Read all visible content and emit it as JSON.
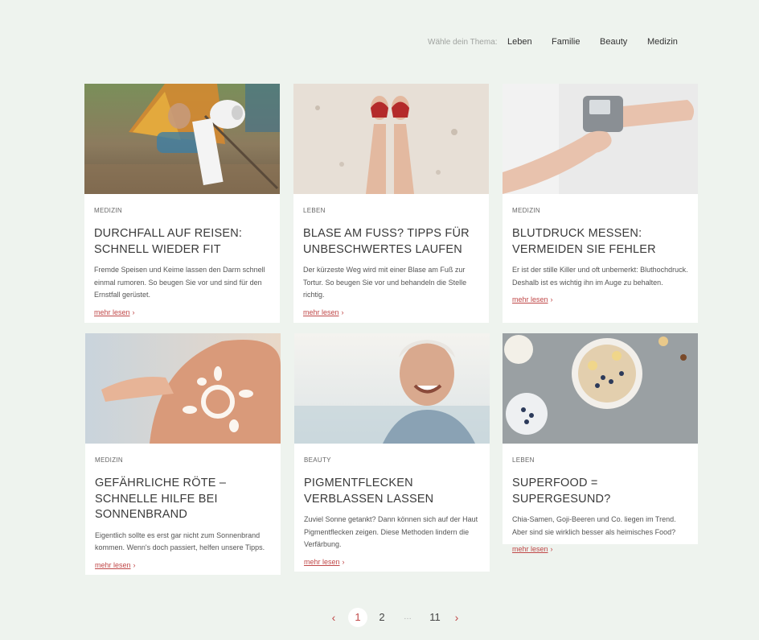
{
  "header": {
    "theme_prompt": "Wähle dein Thema:",
    "nav": [
      "Leben",
      "Familie",
      "Beauty",
      "Medizin"
    ]
  },
  "articles": [
    {
      "category": "MEDIZIN",
      "title": "DURCHFALL AUF REISEN: SCHNELL WIEDER FIT",
      "excerpt": "Fremde Speisen und Keime lassen den Darm schnell einmal rumoren. So beugen Sie vor und sind für den Ernstfall gerüstet.",
      "more": "mehr lesen"
    },
    {
      "category": "LEBEN",
      "title": "BLASE AM FUSS? TIPPS FÜR UNBESCHWERTES LAUFEN",
      "excerpt": "Der kürzeste Weg wird mit einer Blase am Fuß zur Tortur. So beugen Sie vor und behandeln die Stelle richtig.",
      "more": "mehr lesen"
    },
    {
      "category": "MEDIZIN",
      "title": "BLUTDRUCK MESSEN: VERMEIDEN SIE FEHLER",
      "excerpt": "Er ist der stille Killer und oft unbemerkt: Bluthochdruck. Deshalb ist es wichtig ihn im Auge zu behalten.",
      "more": "mehr lesen"
    },
    {
      "category": "MEDIZIN",
      "title": "GEFÄHRLICHE RÖTE – SCHNELLE HILFE BEI SONNENBRAND",
      "excerpt": "Eigentlich sollte es erst gar nicht zum Sonnenbrand kommen. Wenn's doch passiert, helfen unsere Tipps.",
      "more": "mehr lesen"
    },
    {
      "category": "BEAUTY",
      "title": "PIGMENTFLECKEN VERBLASSEN LASSEN",
      "excerpt": "Zuviel Sonne getankt? Dann können sich auf der Haut Pigmentflecken zeigen. Diese Methoden lindern die Verfärbung.",
      "more": "mehr lesen"
    },
    {
      "category": "LEBEN",
      "title": "SUPERFOOD = SUPERGESUND?",
      "excerpt": "Chia-Samen, Goji-Beeren und Co. liegen im Trend. Aber sind sie wirklich besser als heimisches Food?",
      "more": "mehr lesen"
    }
  ],
  "pagination": {
    "prev": "‹",
    "pages": [
      "1",
      "2",
      "…",
      "11"
    ],
    "current": "1",
    "next": "›"
  }
}
